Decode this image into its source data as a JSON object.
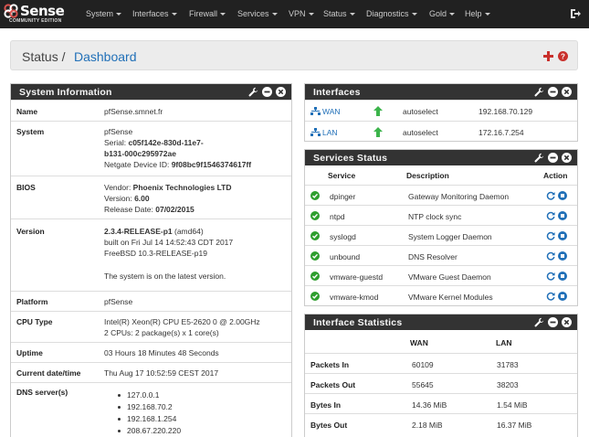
{
  "brand": {
    "name": "Sense",
    "edition": "COMMUNITY EDITION"
  },
  "nav": [
    {
      "label": "System"
    },
    {
      "label": "Interfaces"
    },
    {
      "label": "Firewall"
    },
    {
      "label": "Services"
    },
    {
      "label": "VPN"
    },
    {
      "label": "Status"
    },
    {
      "label": "Diagnostics"
    },
    {
      "label": "Gold"
    },
    {
      "label": "Help"
    }
  ],
  "breadcrumb": {
    "parent": "Status",
    "separator": "/",
    "current": "Dashboard"
  },
  "sysinfo": {
    "title": "System Information",
    "name_label": "Name",
    "name_value": "pfSense.smnet.fr",
    "system_label": "System",
    "system_line1": "pfSense",
    "serial_prefix": "Serial: ",
    "serial_a": "c05f142e-830d-11e7-",
    "serial_b": "b131-000c295972ae",
    "device_prefix": "Netgate Device ID: ",
    "device_id": "9f08bc9f1546374617ff",
    "bios_label": "BIOS",
    "vendor_prefix": "Vendor: ",
    "vendor": "Phoenix Technologies LTD",
    "version_prefix": "Version: ",
    "bios_version": "6.00",
    "release_prefix": "Release Date: ",
    "release_date": "07/02/2015",
    "version_label": "Version",
    "version_main": "2.3.4-RELEASE-p1",
    "version_arch": " (amd64)",
    "built": "built on Fri Jul 14 14:52:43 CDT 2017",
    "freebsd": "FreeBSD 10.3-RELEASE-p19",
    "latest": "The system is on the latest version.",
    "platform_label": "Platform",
    "platform": "pfSense",
    "cpu_label": "CPU Type",
    "cpu1": "Intel(R) Xeon(R) CPU E5-2620 0 @ 2.00GHz",
    "cpu2": "2 CPUs: 2 package(s) x 1 core(s)",
    "uptime_label": "Uptime",
    "uptime": "03 Hours 18 Minutes 48 Seconds",
    "date_label": "Current date/time",
    "date": "Thu Aug 17 10:52:59 CEST 2017",
    "dns_label": "DNS server(s)",
    "dns": [
      "127.0.0.1",
      "192.168.70.2",
      "192.168.1.254",
      "208.67.220.220"
    ]
  },
  "interfaces": {
    "title": "Interfaces",
    "rows": [
      {
        "name": "WAN",
        "media": "autoselect",
        "ip": "192.168.70.129"
      },
      {
        "name": "LAN",
        "media": "autoselect",
        "ip": "172.16.7.254"
      }
    ]
  },
  "services": {
    "title": "Services Status",
    "headers": {
      "service": "Service",
      "description": "Description",
      "action": "Action"
    },
    "rows": [
      {
        "name": "dpinger",
        "desc": "Gateway Monitoring Daemon"
      },
      {
        "name": "ntpd",
        "desc": "NTP clock sync"
      },
      {
        "name": "syslogd",
        "desc": "System Logger Daemon"
      },
      {
        "name": "unbound",
        "desc": "DNS Resolver"
      },
      {
        "name": "vmware-guestd",
        "desc": "VMware Guest Daemon"
      },
      {
        "name": "vmware-kmod",
        "desc": "VMware Kernel Modules"
      }
    ]
  },
  "ifstats": {
    "title": "Interface Statistics",
    "headers": {
      "wan": "WAN",
      "lan": "LAN"
    },
    "rows": [
      {
        "label": "Packets In",
        "wan": "60109",
        "lan": "31783"
      },
      {
        "label": "Packets Out",
        "wan": "55645",
        "lan": "38203"
      },
      {
        "label": "Bytes In",
        "wan": "14.36 MiB",
        "lan": "1.54 MiB"
      },
      {
        "label": "Bytes Out",
        "wan": "2.18 MiB",
        "lan": "16.37 MiB"
      }
    ]
  },
  "colors": {
    "navbar": "#212121",
    "panel_header": "#333333",
    "link": "#2170b8",
    "up_arrow": "#3cb44b",
    "ok_green": "#2e9e2e",
    "red": "#c9302c",
    "action_blue": "#2170b8"
  }
}
